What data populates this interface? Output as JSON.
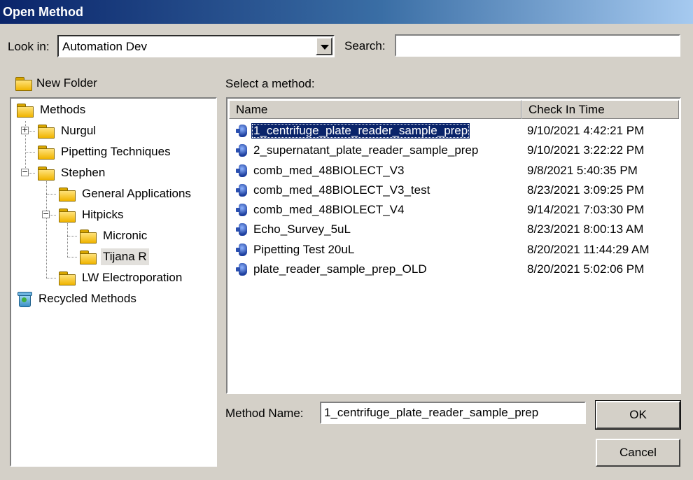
{
  "window": {
    "title": "Open Method"
  },
  "lookin": {
    "label": "Look in:",
    "value": "Automation Dev"
  },
  "search": {
    "label": "Search:",
    "value": "",
    "placeholder": ""
  },
  "new_folder": {
    "label": "New Folder"
  },
  "tree": {
    "root": "Methods",
    "nurgul": "Nurgul",
    "pipetting": "Pipetting Techniques",
    "stephen": "Stephen",
    "general": "General Applications",
    "hitpicks": "Hitpicks",
    "micronic": "Micronic",
    "tijana": "Tijana R",
    "lw": "LW Electroporation",
    "recycled": "Recycled Methods",
    "selected": "Tijana R"
  },
  "list": {
    "prompt": "Select a method:",
    "col_name": "Name",
    "col_time": "Check In Time",
    "rows": [
      {
        "name": "1_centrifuge_plate_reader_sample_prep",
        "time": "9/10/2021 4:42:21 PM"
      },
      {
        "name": "2_supernatant_plate_reader_sample_prep",
        "time": "9/10/2021 3:22:22 PM"
      },
      {
        "name": "comb_med_48BIOLECT_V3",
        "time": "9/8/2021 5:40:35 PM"
      },
      {
        "name": "comb_med_48BIOLECT_V3_test",
        "time": "8/23/2021 3:09:25 PM"
      },
      {
        "name": "comb_med_48BIOLECT_V4",
        "time": "9/14/2021 7:03:30 PM"
      },
      {
        "name": "Echo_Survey_5uL",
        "time": "8/23/2021 8:00:13 AM"
      },
      {
        "name": "Pipetting Test 20uL",
        "time": "8/20/2021 11:44:29 AM"
      },
      {
        "name": "plate_reader_sample_prep_OLD",
        "time": "8/20/2021 5:02:06 PM"
      }
    ],
    "selected": "1_centrifuge_plate_reader_sample_prep"
  },
  "method_name": {
    "label": "Method Name:",
    "value": "1_centrifuge_plate_reader_sample_prep"
  },
  "buttons": {
    "ok": "OK",
    "cancel": "Cancel"
  }
}
